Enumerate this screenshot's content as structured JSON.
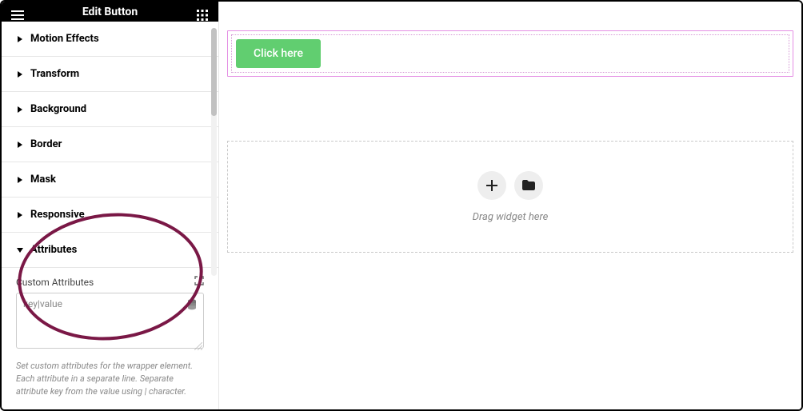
{
  "header": {
    "title": "Edit Button"
  },
  "panels": {
    "motion": "Motion Effects",
    "transform": "Transform",
    "background": "Background",
    "border": "Border",
    "mask": "Mask",
    "responsive": "Responsive",
    "attributes": "Attributes"
  },
  "attributes_section": {
    "field_label": "Custom Attributes",
    "placeholder": "key|value",
    "value": "",
    "help": "Set custom attributes for the wrapper element. Each attribute in a separate line. Separate attribute key from the value using | character."
  },
  "canvas": {
    "button_label": "Click here",
    "drop_hint": "Drag widget here"
  },
  "icons": {
    "hamburger": "hamburger-icon",
    "apps_grid": "apps-grid-icon",
    "caret_right": "caret-right-icon",
    "caret_down": "caret-down-icon",
    "dynamic": "database-icon",
    "expand": "expand-icon",
    "plus": "plus-icon",
    "folder": "folder-icon",
    "chevron_left": "chevron-left-icon"
  },
  "colors": {
    "accent_green": "#61ce70",
    "selection_pink": "#e48fe4",
    "annotation": "#7a1846"
  }
}
